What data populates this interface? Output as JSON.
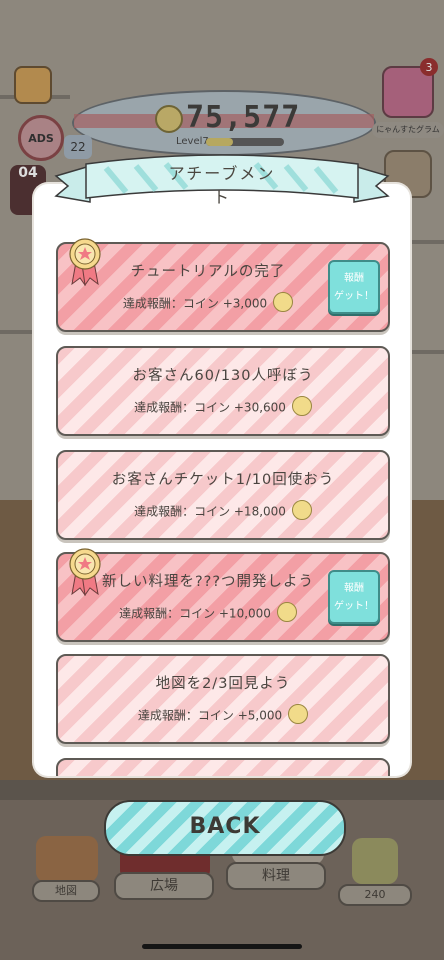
{
  "hud": {
    "coins": "75,577",
    "level_label": "Level7",
    "level_progress": 0.35,
    "ads_label": "ADS",
    "notice_badge": "22",
    "timer": "04",
    "instagram_badge": "3",
    "instagram_label": "にゃんすたグラム",
    "right_label": "メント"
  },
  "modal": {
    "title": "アチーブメント",
    "achievements": [
      {
        "title": "チュートリアルの完了",
        "reward": "達成報酬：コイン +3,000",
        "completed": true,
        "claim_label_1": "報酬",
        "claim_label_2": "ゲット！"
      },
      {
        "title": "お客さん60/130人呼ぼう",
        "reward": "達成報酬：コイン +30,600",
        "completed": false
      },
      {
        "title": "お客さんチケット1/10回使おう",
        "reward": "達成報酬：コイン +18,000",
        "completed": false
      },
      {
        "title": "新しい料理を???つ開発しよう",
        "reward": "達成報酬：コイン +10,000",
        "completed": true,
        "claim_label_1": "報酬",
        "claim_label_2": "ゲット！"
      },
      {
        "title": "地図を2/3回見よう",
        "reward": "達成報酬：コイン +5,000",
        "completed": false
      }
    ]
  },
  "back_label": "BACK",
  "bottom_nav": {
    "map": "地図",
    "plaza": "広場",
    "cooking": "料理",
    "house_count": "240"
  },
  "colors": {
    "card_done": "#f39fa5",
    "card_pending": "#f7c9cb",
    "claim_button": "#7fe0dc",
    "back_button": "#7ed8d9"
  }
}
